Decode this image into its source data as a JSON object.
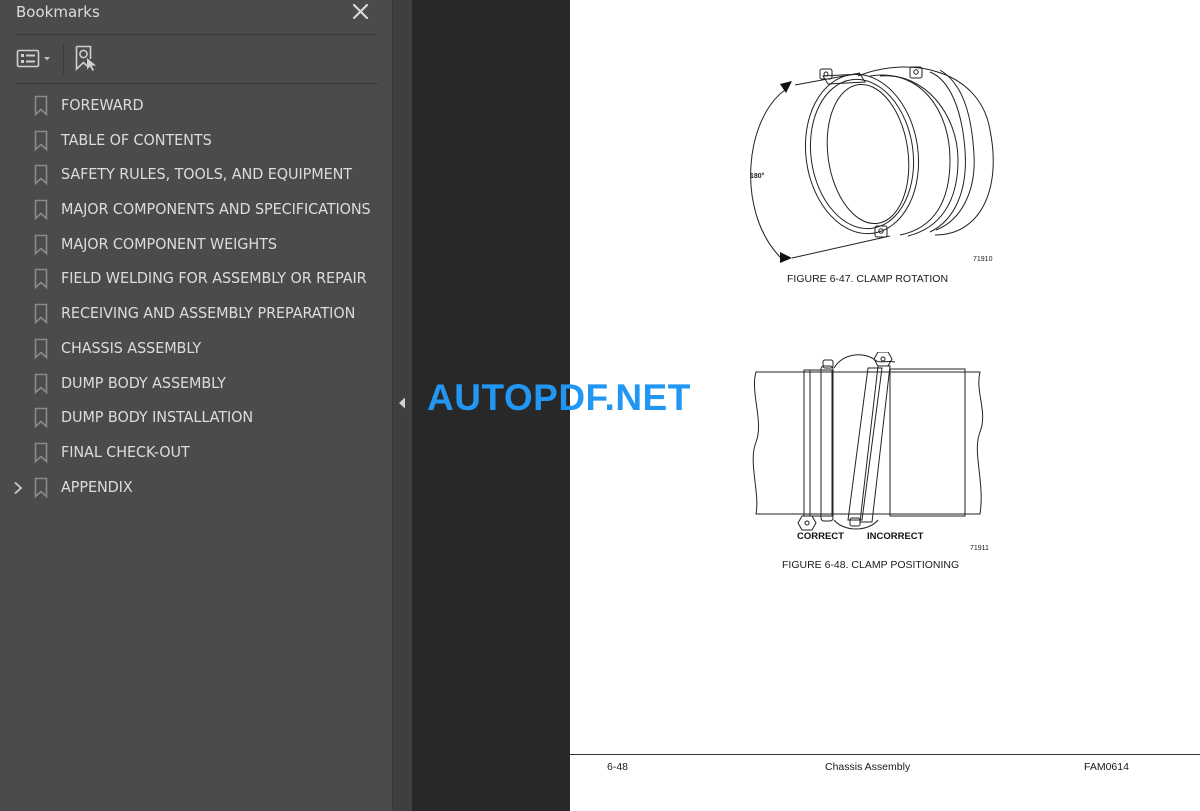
{
  "bookmarks_panel": {
    "title": "Bookmarks",
    "close_icon": "close-icon",
    "toolbar": {
      "options_icon": "list-options-icon",
      "find_icon": "find-current-bookmark-icon"
    },
    "items": [
      {
        "label": "FOREWARD",
        "expandable": false
      },
      {
        "label": "TABLE OF CONTENTS",
        "expandable": false
      },
      {
        "label": "SAFETY RULES, TOOLS, AND EQUIPMENT",
        "expandable": false
      },
      {
        "label": "MAJOR COMPONENTS AND SPECIFICATIONS",
        "expandable": false
      },
      {
        "label": "MAJOR COMPONENT WEIGHTS",
        "expandable": false
      },
      {
        "label": "FIELD WELDING FOR ASSEMBLY OR REPAIR",
        "expandable": false
      },
      {
        "label": "RECEIVING AND ASSEMBLY PREPARATION",
        "expandable": false
      },
      {
        "label": "CHASSIS ASSEMBLY",
        "expandable": false
      },
      {
        "label": "DUMP BODY ASSEMBLY",
        "expandable": false
      },
      {
        "label": "DUMP BODY INSTALLATION",
        "expandable": false
      },
      {
        "label": "FINAL CHECK-OUT",
        "expandable": false
      },
      {
        "label": "APPENDIX",
        "expandable": true
      }
    ]
  },
  "collapse_icon": "collapse-panel-left-icon",
  "watermark": "AUTOPDF.NET",
  "page": {
    "figure1": {
      "caption": "FIGURE 6-47. CLAMP ROTATION",
      "number": "71910",
      "angle_label": "180°"
    },
    "figure2": {
      "caption": "FIGURE 6-48. CLAMP POSITIONING",
      "number": "71911",
      "label_correct": "CORRECT",
      "label_incorrect": "INCORRECT"
    },
    "footer": {
      "page_number": "6-48",
      "section": "Chassis Assembly",
      "doc_code": "FAM0614"
    }
  },
  "colors": {
    "panel_bg": "#4b4b4b",
    "canvas_bg": "#282828",
    "watermark": "#2196f3",
    "panel_text": "#dcdcdc"
  }
}
